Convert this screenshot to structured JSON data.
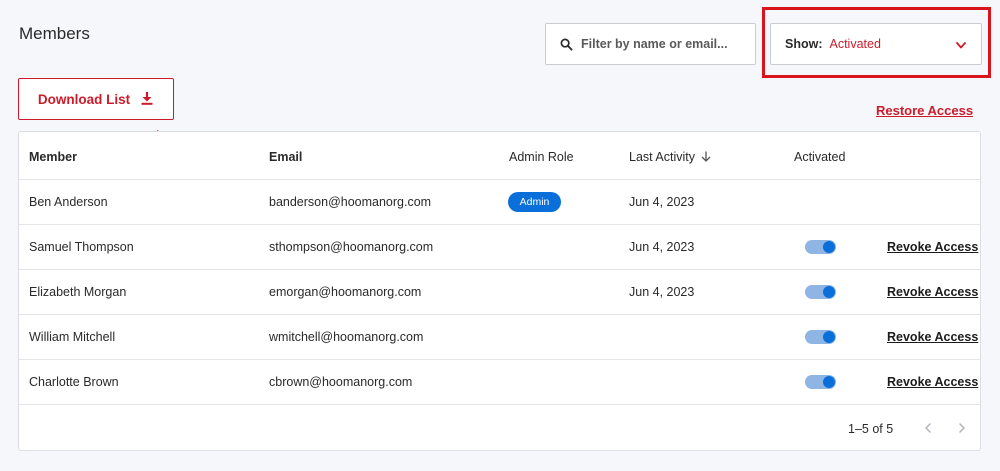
{
  "page": {
    "title": "Members"
  },
  "search": {
    "placeholder": "Filter by name or email...",
    "icon": "search-icon"
  },
  "filter": {
    "label": "Show:",
    "value": "Activated",
    "icon": "chevron-down-icon"
  },
  "toolbar": {
    "download_label": "Download List",
    "download_icon": "download-icon",
    "restore_label": "Restore Access"
  },
  "table": {
    "headers": {
      "member": "Member",
      "email": "Email",
      "admin_role": "Admin Role",
      "last_activity": "Last Activity",
      "activated": "Activated"
    },
    "rows": [
      {
        "name": "Ben Anderson",
        "email": "banderson@hoomanorg.com",
        "role": "Admin",
        "last_activity": "Jun 4, 2023",
        "activated": null,
        "action": ""
      },
      {
        "name": "Samuel Thompson",
        "email": "sthompson@hoomanorg.com",
        "role": "",
        "last_activity": "Jun 4, 2023",
        "activated": true,
        "action": "Revoke Access"
      },
      {
        "name": "Elizabeth Morgan",
        "email": "emorgan@hoomanorg.com",
        "role": "",
        "last_activity": "Jun 4, 2023",
        "activated": true,
        "action": "Revoke Access"
      },
      {
        "name": "William Mitchell",
        "email": "wmitchell@hoomanorg.com",
        "role": "",
        "last_activity": "",
        "activated": true,
        "action": "Revoke Access"
      },
      {
        "name": "Charlotte Brown",
        "email": "cbrown@hoomanorg.com",
        "role": "",
        "last_activity": "",
        "activated": true,
        "action": "Revoke Access"
      }
    ]
  },
  "pagination": {
    "range": "1–5 of 5"
  },
  "colors": {
    "accent": "#cc1c2b",
    "highlight": "#d9141b",
    "toggle_on": "#0a6fd8",
    "badge": "#0a6fd8"
  }
}
